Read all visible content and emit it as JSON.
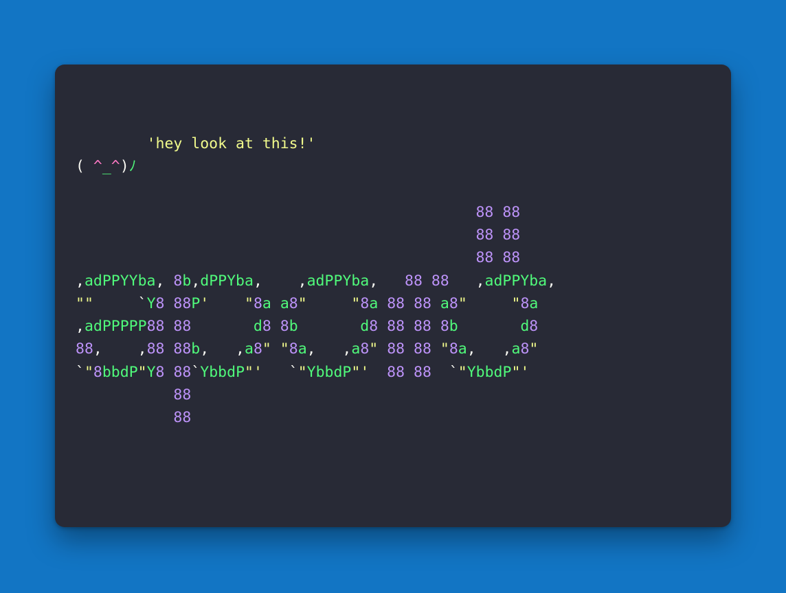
{
  "colors": {
    "page_bg": "#1275c4",
    "card_bg": "#282a36",
    "default": "#f8f8f2",
    "string": "#f1fa8c",
    "pink": "#ff79c6",
    "green": "#50fa7b",
    "purple": "#bd93f9"
  },
  "code": {
    "lines": [
      [
        [
          "default",
          "\n"
        ]
      ],
      [
        [
          "default",
          "\n"
        ]
      ],
      [
        [
          "default",
          "        "
        ],
        [
          "string",
          "'hey look at this!'"
        ],
        [
          "default",
          "\n"
        ]
      ],
      [
        [
          "paren",
          "( "
        ],
        [
          "pink",
          "^"
        ],
        [
          "green",
          "_"
        ],
        [
          "pink",
          "^"
        ],
        [
          "paren",
          ")"
        ],
        [
          "green",
          "ﾉ"
        ],
        [
          "default",
          "\n"
        ]
      ],
      [
        [
          "default",
          "\n"
        ]
      ],
      [
        [
          "default",
          "                                             "
        ],
        [
          "purple",
          "88"
        ],
        [
          "default",
          " "
        ],
        [
          "purple",
          "88"
        ],
        [
          "default",
          "\n"
        ]
      ],
      [
        [
          "default",
          "                                             "
        ],
        [
          "purple",
          "88"
        ],
        [
          "default",
          " "
        ],
        [
          "purple",
          "88"
        ],
        [
          "default",
          "\n"
        ]
      ],
      [
        [
          "default",
          "                                             "
        ],
        [
          "purple",
          "88"
        ],
        [
          "default",
          " "
        ],
        [
          "purple",
          "88"
        ],
        [
          "default",
          "\n"
        ]
      ],
      [
        [
          "default",
          ","
        ],
        [
          "green",
          "adPPYYba"
        ],
        [
          "default",
          ", "
        ],
        [
          "purple",
          "8"
        ],
        [
          "green",
          "b"
        ],
        [
          "default",
          ","
        ],
        [
          "green",
          "dPPYba"
        ],
        [
          "default",
          ",    ,"
        ],
        [
          "green",
          "adPPYba"
        ],
        [
          "default",
          ",   "
        ],
        [
          "purple",
          "88"
        ],
        [
          "default",
          " "
        ],
        [
          "purple",
          "88"
        ],
        [
          "default",
          "   ,"
        ],
        [
          "green",
          "adPPYba"
        ],
        [
          "default",
          ",\n"
        ]
      ],
      [
        [
          "string",
          "\"\""
        ],
        [
          "default",
          "     `"
        ],
        [
          "green",
          "Y"
        ],
        [
          "purple",
          "8"
        ],
        [
          "default",
          " "
        ],
        [
          "purple",
          "88"
        ],
        [
          "green",
          "P"
        ],
        [
          "string",
          "'"
        ],
        [
          "default",
          "    "
        ],
        [
          "string",
          "\""
        ],
        [
          "purple",
          "8"
        ],
        [
          "green",
          "a"
        ],
        [
          "default",
          " "
        ],
        [
          "green",
          "a"
        ],
        [
          "purple",
          "8"
        ],
        [
          "string",
          "\""
        ],
        [
          "default",
          "     "
        ],
        [
          "string",
          "\""
        ],
        [
          "purple",
          "8"
        ],
        [
          "green",
          "a"
        ],
        [
          "default",
          " "
        ],
        [
          "purple",
          "88"
        ],
        [
          "default",
          " "
        ],
        [
          "purple",
          "88"
        ],
        [
          "default",
          " "
        ],
        [
          "green",
          "a"
        ],
        [
          "purple",
          "8"
        ],
        [
          "string",
          "\""
        ],
        [
          "default",
          "     "
        ],
        [
          "string",
          "\""
        ],
        [
          "purple",
          "8"
        ],
        [
          "green",
          "a"
        ],
        [
          "default",
          "\n"
        ]
      ],
      [
        [
          "default",
          ","
        ],
        [
          "green",
          "adPPPPP"
        ],
        [
          "purple",
          "88"
        ],
        [
          "default",
          " "
        ],
        [
          "purple",
          "88"
        ],
        [
          "default",
          "       "
        ],
        [
          "green",
          "d"
        ],
        [
          "purple",
          "8"
        ],
        [
          "default",
          " "
        ],
        [
          "purple",
          "8"
        ],
        [
          "green",
          "b"
        ],
        [
          "default",
          "       "
        ],
        [
          "green",
          "d"
        ],
        [
          "purple",
          "8"
        ],
        [
          "default",
          " "
        ],
        [
          "purple",
          "88"
        ],
        [
          "default",
          " "
        ],
        [
          "purple",
          "88"
        ],
        [
          "default",
          " "
        ],
        [
          "purple",
          "8"
        ],
        [
          "green",
          "b"
        ],
        [
          "default",
          "       "
        ],
        [
          "green",
          "d"
        ],
        [
          "purple",
          "8"
        ],
        [
          "default",
          "\n"
        ]
      ],
      [
        [
          "purple",
          "88"
        ],
        [
          "default",
          ",    ,"
        ],
        [
          "purple",
          "88"
        ],
        [
          "default",
          " "
        ],
        [
          "purple",
          "88"
        ],
        [
          "green",
          "b"
        ],
        [
          "default",
          ",   ,"
        ],
        [
          "green",
          "a"
        ],
        [
          "purple",
          "8"
        ],
        [
          "string",
          "\""
        ],
        [
          "default",
          " "
        ],
        [
          "string",
          "\""
        ],
        [
          "purple",
          "8"
        ],
        [
          "green",
          "a"
        ],
        [
          "default",
          ",   ,"
        ],
        [
          "green",
          "a"
        ],
        [
          "purple",
          "8"
        ],
        [
          "string",
          "\""
        ],
        [
          "default",
          " "
        ],
        [
          "purple",
          "88"
        ],
        [
          "default",
          " "
        ],
        [
          "purple",
          "88"
        ],
        [
          "default",
          " "
        ],
        [
          "string",
          "\""
        ],
        [
          "purple",
          "8"
        ],
        [
          "green",
          "a"
        ],
        [
          "default",
          ",   ,"
        ],
        [
          "green",
          "a"
        ],
        [
          "purple",
          "8"
        ],
        [
          "string",
          "\""
        ],
        [
          "default",
          "\n"
        ]
      ],
      [
        [
          "default",
          "`"
        ],
        [
          "string",
          "\""
        ],
        [
          "purple",
          "8"
        ],
        [
          "green",
          "bbdP"
        ],
        [
          "string",
          "\""
        ],
        [
          "green",
          "Y"
        ],
        [
          "purple",
          "8"
        ],
        [
          "default",
          " "
        ],
        [
          "purple",
          "88"
        ],
        [
          "default",
          "`"
        ],
        [
          "green",
          "YbbdP"
        ],
        [
          "string",
          "\"'"
        ],
        [
          "default",
          "   `"
        ],
        [
          "string",
          "\""
        ],
        [
          "green",
          "YbbdP"
        ],
        [
          "string",
          "\"'"
        ],
        [
          "default",
          "  "
        ],
        [
          "purple",
          "88"
        ],
        [
          "default",
          " "
        ],
        [
          "purple",
          "88"
        ],
        [
          "default",
          "  `"
        ],
        [
          "string",
          "\""
        ],
        [
          "green",
          "YbbdP"
        ],
        [
          "string",
          "\"'"
        ],
        [
          "default",
          "\n"
        ]
      ],
      [
        [
          "default",
          "           "
        ],
        [
          "purple",
          "88"
        ],
        [
          "default",
          "\n"
        ]
      ],
      [
        [
          "default",
          "           "
        ],
        [
          "purple",
          "88"
        ],
        [
          "default",
          "\n"
        ]
      ]
    ]
  }
}
